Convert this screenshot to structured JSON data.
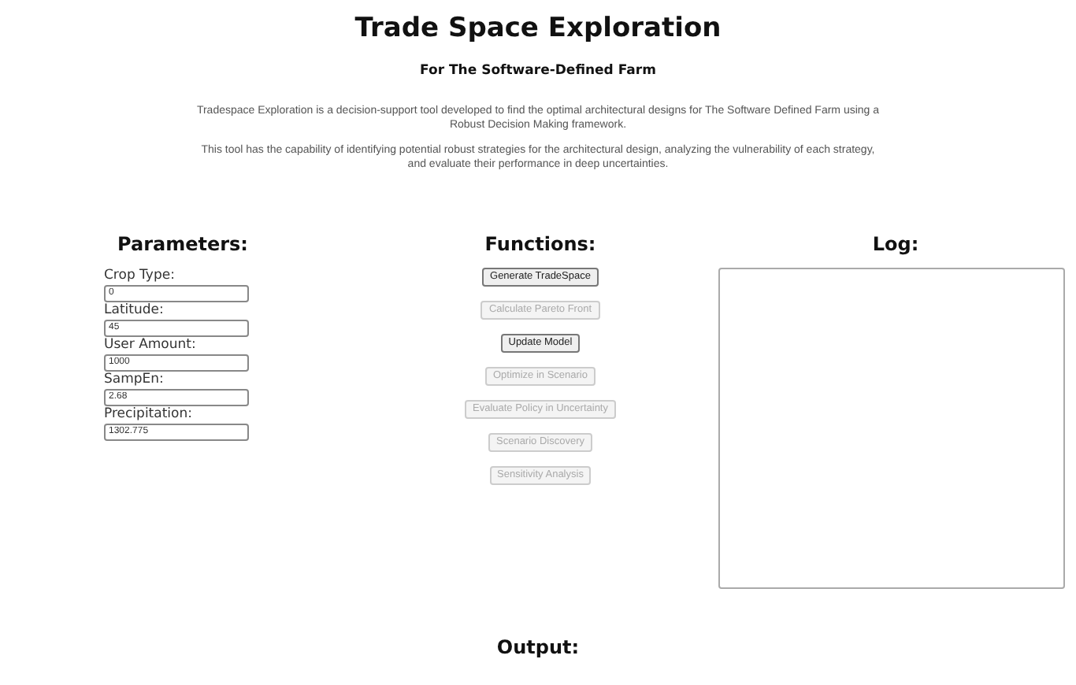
{
  "title": "Trade Space Exploration",
  "subtitle": "For The Software-Defined Farm",
  "paragraphs": [
    "Tradespace Exploration is a decision-support tool developed to find the optimal architectural designs for The Software Defined Farm using a Robust Decision Making framework.",
    "This tool has the capability of identifying potential robust strategies for the architectural design, analyzing the vulnerability of each strategy, and evaluate their performance in deep uncertainties."
  ],
  "parameters": {
    "heading": "Parameters:",
    "fields": [
      {
        "label": "Crop Type:",
        "value": "0"
      },
      {
        "label": "Latitude:",
        "value": "45"
      },
      {
        "label": "User Amount:",
        "value": "1000"
      },
      {
        "label": "SampEn:",
        "value": "2.68"
      },
      {
        "label": "Precipitation:",
        "value": "1302.775"
      }
    ]
  },
  "functions": {
    "heading": "Functions:",
    "buttons": [
      {
        "label": "Generate TradeSpace",
        "disabled": false
      },
      {
        "label": "Calculate Pareto Front",
        "disabled": true
      },
      {
        "label": "Update Model",
        "disabled": false
      },
      {
        "label": "Optimize in Scenario",
        "disabled": true
      },
      {
        "label": "Evaluate Policy in Uncertainty",
        "disabled": true
      },
      {
        "label": "Scenario Discovery",
        "disabled": true
      },
      {
        "label": "Sensitivity Analysis",
        "disabled": true
      }
    ]
  },
  "log": {
    "heading": "Log:"
  },
  "output": {
    "heading": "Output:"
  }
}
